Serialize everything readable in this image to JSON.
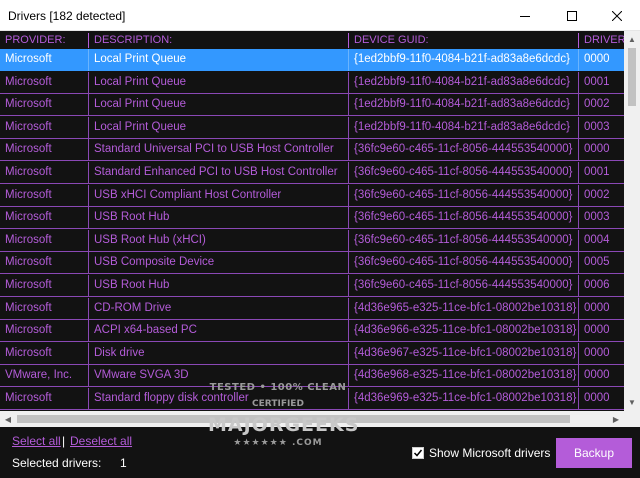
{
  "window": {
    "title": "Drivers [182 detected]"
  },
  "columns": [
    "PROVIDER:",
    "DESCRIPTION:",
    "DEVICE GUID:",
    "DRIVER"
  ],
  "rows": [
    {
      "provider": "Microsoft",
      "description": "Local Print Queue",
      "guid": "{1ed2bbf9-11f0-4084-b21f-ad83a8e6dcdc}",
      "driver": "0000",
      "selected": true
    },
    {
      "provider": "Microsoft",
      "description": "Local Print Queue",
      "guid": "{1ed2bbf9-11f0-4084-b21f-ad83a8e6dcdc}",
      "driver": "0001"
    },
    {
      "provider": "Microsoft",
      "description": "Local Print Queue",
      "guid": "{1ed2bbf9-11f0-4084-b21f-ad83a8e6dcdc}",
      "driver": "0002"
    },
    {
      "provider": "Microsoft",
      "description": "Local Print Queue",
      "guid": "{1ed2bbf9-11f0-4084-b21f-ad83a8e6dcdc}",
      "driver": "0003"
    },
    {
      "provider": "Microsoft",
      "description": "Standard Universal PCI to USB Host Controller",
      "guid": "{36fc9e60-c465-11cf-8056-444553540000}",
      "driver": "0000"
    },
    {
      "provider": "Microsoft",
      "description": "Standard Enhanced PCI to USB Host Controller",
      "guid": "{36fc9e60-c465-11cf-8056-444553540000}",
      "driver": "0001"
    },
    {
      "provider": "Microsoft",
      "description": "USB xHCI Compliant Host Controller",
      "guid": "{36fc9e60-c465-11cf-8056-444553540000}",
      "driver": "0002"
    },
    {
      "provider": "Microsoft",
      "description": "USB Root Hub",
      "guid": "{36fc9e60-c465-11cf-8056-444553540000}",
      "driver": "0003"
    },
    {
      "provider": "Microsoft",
      "description": "USB Root Hub (xHCI)",
      "guid": "{36fc9e60-c465-11cf-8056-444553540000}",
      "driver": "0004"
    },
    {
      "provider": "Microsoft",
      "description": "USB Composite Device",
      "guid": "{36fc9e60-c465-11cf-8056-444553540000}",
      "driver": "0005"
    },
    {
      "provider": "Microsoft",
      "description": "USB Root Hub",
      "guid": "{36fc9e60-c465-11cf-8056-444553540000}",
      "driver": "0006"
    },
    {
      "provider": "Microsoft",
      "description": "CD-ROM Drive",
      "guid": "{4d36e965-e325-11ce-bfc1-08002be10318}",
      "driver": "0000"
    },
    {
      "provider": "Microsoft",
      "description": "ACPI x64-based PC",
      "guid": "{4d36e966-e325-11ce-bfc1-08002be10318}",
      "driver": "0000"
    },
    {
      "provider": "Microsoft",
      "description": "Disk drive",
      "guid": "{4d36e967-e325-11ce-bfc1-08002be10318}",
      "driver": "0000"
    },
    {
      "provider": "VMware, Inc.",
      "description": "VMware SVGA 3D",
      "guid": "{4d36e968-e325-11ce-bfc1-08002be10318}",
      "driver": "0000"
    },
    {
      "provider": "Microsoft",
      "description": "Standard floppy disk controller",
      "guid": "{4d36e969-e325-11ce-bfc1-08002be10318}",
      "driver": "0000"
    }
  ],
  "footer": {
    "select_all": "Select all",
    "separator": "|",
    "deselect_all": "Deselect all",
    "selected_label": "Selected drivers:",
    "selected_count": "1",
    "show_microsoft_label": "Show Microsoft drivers",
    "show_microsoft_checked": true,
    "backup_label": "Backup"
  },
  "watermark": {
    "line1": "TESTED • 100% CLEAN",
    "line2": "CERTIFIED",
    "line3": "MAJORGEEKS",
    "line4": "★★★★★★ .COM"
  },
  "colors": {
    "accent": "#b45cd9",
    "background": "#121212",
    "selection": "#3398ff"
  }
}
